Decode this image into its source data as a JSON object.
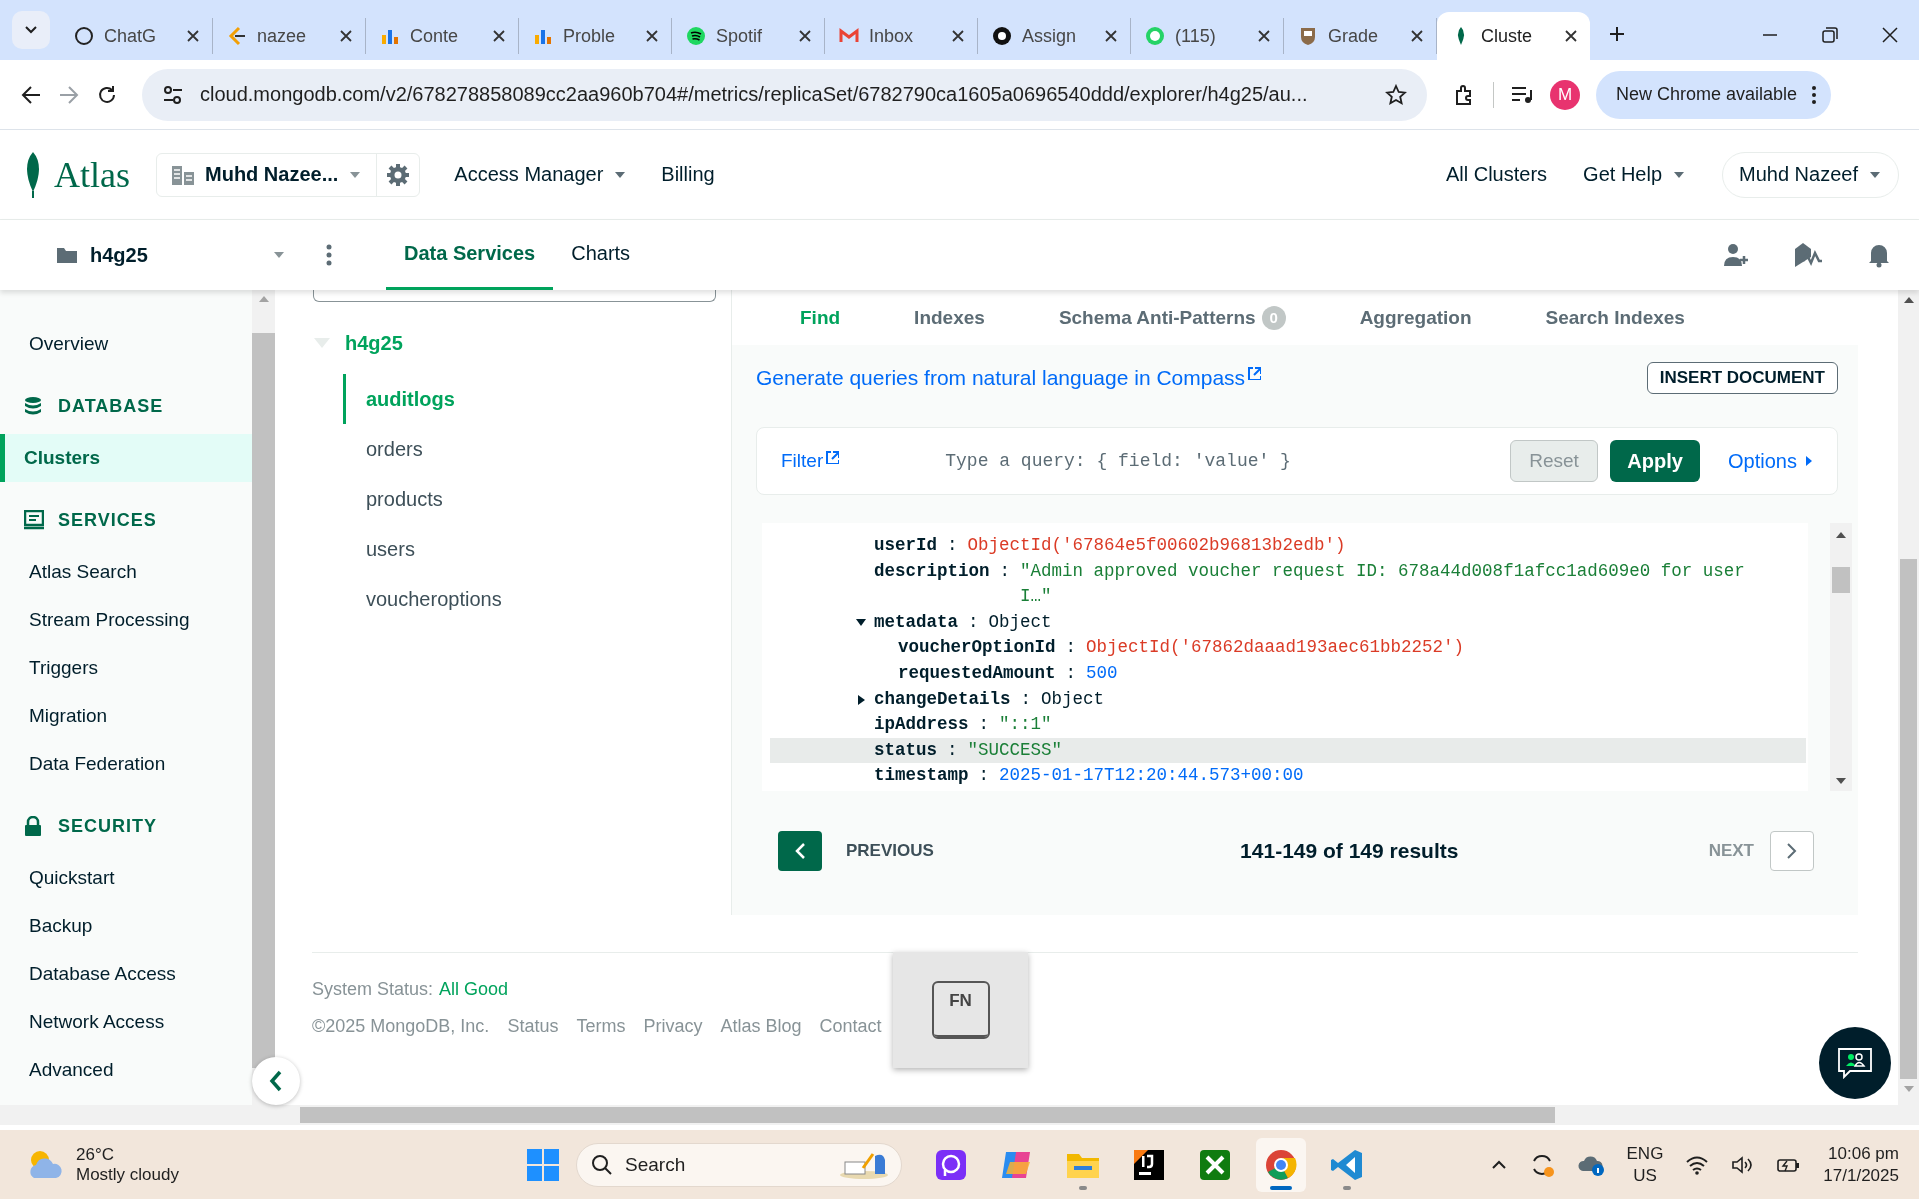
{
  "browser": {
    "tabs": [
      {
        "title": "ChatG",
        "selected": false
      },
      {
        "title": "nazee",
        "selected": false
      },
      {
        "title": "Conte",
        "selected": false
      },
      {
        "title": "Proble",
        "selected": false
      },
      {
        "title": "Spotif",
        "selected": false
      },
      {
        "title": "Inbox",
        "selected": false
      },
      {
        "title": "Assign",
        "selected": false
      },
      {
        "title": "(115)",
        "selected": false
      },
      {
        "title": "Grade",
        "selected": false
      },
      {
        "title": "Cluste",
        "selected": true
      }
    ],
    "address": "cloud.mongodb.com/v2/678278858089cc2aa960b704#/metrics/replicaSet/6782790ca1605a0696540ddd/explorer/h4g25/au...",
    "profile_initial": "M",
    "update_button": "New Chrome available"
  },
  "atlas_header": {
    "logo": "Atlas",
    "organization": "Muhd Nazee...",
    "nav": [
      "Access Manager",
      "Billing"
    ],
    "nav_dropdown": [
      true,
      false
    ],
    "right": [
      {
        "label": "All Clusters",
        "dropdown": false,
        "boxed": false
      },
      {
        "label": "Get Help",
        "dropdown": true,
        "boxed": false
      },
      {
        "label": "Muhd Nazeef",
        "dropdown": true,
        "boxed": true
      }
    ]
  },
  "project_bar": {
    "project": "h4g25",
    "tabs": [
      {
        "label": "Data Services",
        "selected": true
      },
      {
        "label": "Charts",
        "selected": false
      }
    ]
  },
  "sidebar": {
    "items": [
      {
        "kind": "link",
        "label": "Overview",
        "selected": false
      },
      {
        "kind": "section",
        "label": "DATABASE"
      },
      {
        "kind": "link",
        "label": "Clusters",
        "selected": true
      },
      {
        "kind": "section",
        "label": "SERVICES"
      },
      {
        "kind": "link",
        "label": "Atlas Search",
        "selected": false
      },
      {
        "kind": "link",
        "label": "Stream Processing",
        "selected": false
      },
      {
        "kind": "link",
        "label": "Triggers",
        "selected": false
      },
      {
        "kind": "link",
        "label": "Migration",
        "selected": false
      },
      {
        "kind": "link",
        "label": "Data Federation",
        "selected": false
      },
      {
        "kind": "section",
        "label": "SECURITY"
      },
      {
        "kind": "link",
        "label": "Quickstart",
        "selected": false
      },
      {
        "kind": "link",
        "label": "Backup",
        "selected": false
      },
      {
        "kind": "link",
        "label": "Database Access",
        "selected": false
      },
      {
        "kind": "link",
        "label": "Network Access",
        "selected": false
      },
      {
        "kind": "link",
        "label": "Advanced",
        "selected": false
      }
    ]
  },
  "collections": {
    "database": "h4g25",
    "expanded": true,
    "items": [
      {
        "name": "auditlogs",
        "selected": true
      },
      {
        "name": "orders",
        "selected": false
      },
      {
        "name": "products",
        "selected": false
      },
      {
        "name": "users",
        "selected": false
      },
      {
        "name": "voucheroptions",
        "selected": false
      }
    ]
  },
  "main": {
    "tabs": [
      {
        "label": "Find",
        "selected": true
      },
      {
        "label": "Indexes",
        "selected": false
      },
      {
        "label": "Schema Anti-Patterns",
        "selected": false,
        "badge": "0"
      },
      {
        "label": "Aggregation",
        "selected": false
      },
      {
        "label": "Search Indexes",
        "selected": false
      }
    ],
    "compass_link": "Generate queries from natural language in Compass",
    "insert_button": "INSERT DOCUMENT",
    "filter": {
      "label": "Filter",
      "placeholder": "Type a query: { field: 'value' }",
      "reset": "Reset",
      "apply": "Apply",
      "options": "Options"
    },
    "document": [
      {
        "key": "userId",
        "colon": ":",
        "value": "ObjectId('67864e5f00602b96813b2edb')",
        "kind": "objectid",
        "highlighted": false
      },
      {
        "key": "description",
        "colon": ":",
        "value": "\"Admin approved voucher request ID: 678a44d008f1afcc1ad609e0 for user I…\"",
        "kind": "string",
        "highlighted": false
      },
      {
        "key": "metadata",
        "colon": ":",
        "value": "Object",
        "kind": "object",
        "expanded": true,
        "highlighted": false,
        "children": [
          {
            "key": "voucherOptionId",
            "colon": ":",
            "value": "ObjectId('67862daaad193aec61bb2252')",
            "kind": "objectid",
            "highlighted": false
          },
          {
            "key": "requestedAmount",
            "colon": ":",
            "value": "500",
            "kind": "number",
            "highlighted": false
          }
        ]
      },
      {
        "key": "changeDetails",
        "colon": ":",
        "value": "Object",
        "kind": "object",
        "expanded": false,
        "highlighted": false
      },
      {
        "key": "ipAddress",
        "colon": ":",
        "value": "\"::1\"",
        "kind": "string",
        "highlighted": false
      },
      {
        "key": "status",
        "colon": ":",
        "value": "\"SUCCESS\"",
        "kind": "string",
        "highlighted": true
      },
      {
        "key": "timestamp",
        "colon": ":",
        "value": "2025-01-17T12:20:44.573+00:00",
        "kind": "date",
        "highlighted": false
      }
    ],
    "pagination": {
      "previous": "PREVIOUS",
      "previous_disabled": false,
      "results": "141-149 of 149 results",
      "next": "NEXT",
      "next_disabled": true
    }
  },
  "footer": {
    "status_label": "System Status:",
    "status_value": "All Good",
    "copyright": "©2025 MongoDB, Inc.",
    "links": [
      "Status",
      "Terms",
      "Privacy",
      "Atlas Blog",
      "Contact"
    ]
  },
  "key_overlay": "FN",
  "taskbar": {
    "temperature": "26°C",
    "weather": "Mostly cloudy",
    "search": "Search",
    "apps": [
      {
        "running": false,
        "selected": false
      },
      {
        "running": false,
        "selected": false
      },
      {
        "running": true,
        "selected": false
      },
      {
        "running": false,
        "selected": false
      },
      {
        "running": false,
        "selected": false
      },
      {
        "running": true,
        "selected": true
      },
      {
        "running": true,
        "selected": false
      }
    ],
    "language": "ENG",
    "region": "US",
    "time": "10:06 pm",
    "date": "17/1/2025"
  }
}
